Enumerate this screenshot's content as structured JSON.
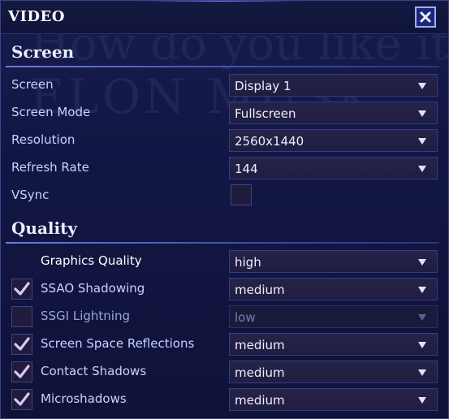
{
  "window": {
    "title": "VIDEO"
  },
  "background_text": {
    "line1": "How do you like it,",
    "line2": "ELON MUSK"
  },
  "screen_section": {
    "heading": "Screen",
    "rows": [
      {
        "label": "Screen",
        "value": "Display 1"
      },
      {
        "label": "Screen Mode",
        "value": "Fullscreen"
      },
      {
        "label": "Resolution",
        "value": "2560x1440"
      },
      {
        "label": "Refresh Rate",
        "value": "144"
      }
    ],
    "vsync": {
      "label": "VSync",
      "checked": false
    }
  },
  "quality_section": {
    "heading": "Quality",
    "graphics_quality": {
      "label": "Graphics Quality",
      "value": "high"
    },
    "rows": [
      {
        "label": "SSAO Shadowing",
        "value": "medium",
        "checked": true
      },
      {
        "label": "SSGI Lightning",
        "value": "low",
        "checked": false,
        "disabled": true
      },
      {
        "label": "Screen Space Reflections",
        "value": "medium",
        "checked": true
      },
      {
        "label": "Contact Shadows",
        "value": "medium",
        "checked": true
      },
      {
        "label": "Microshadows",
        "value": "medium",
        "checked": true
      }
    ]
  },
  "colors": {
    "accent": "#6f83ff",
    "check": "#d7c8ff"
  },
  "icons": {
    "close": "close-icon",
    "dropdown": "chevron-down-icon",
    "check": "check-icon"
  }
}
